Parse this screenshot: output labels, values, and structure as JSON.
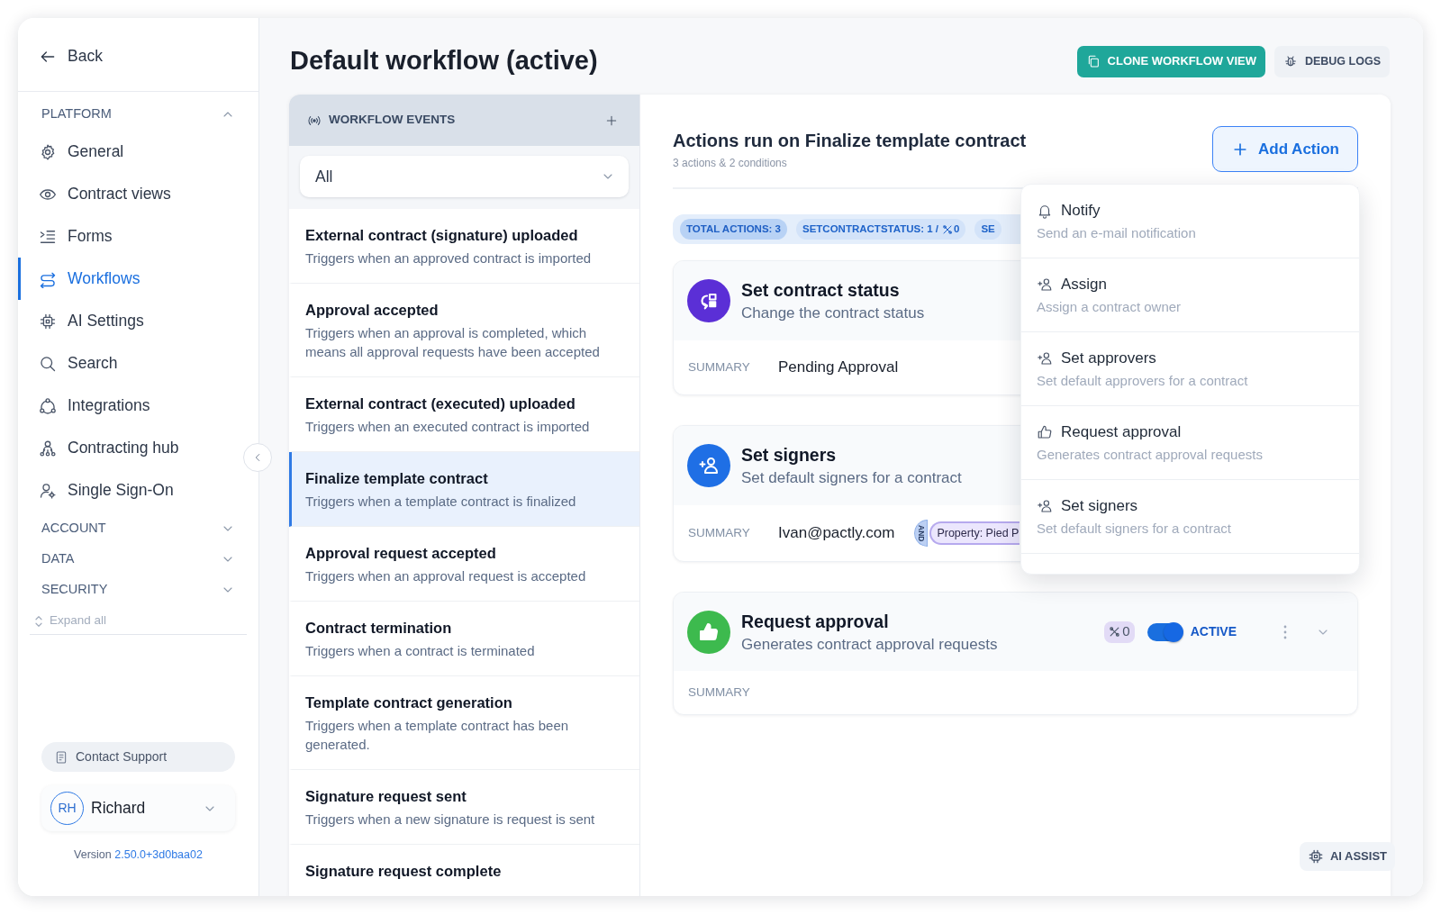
{
  "sidebar": {
    "back": "Back",
    "sections": [
      {
        "title": "PLATFORM",
        "expanded": true,
        "items": [
          {
            "label": "General",
            "selected": false
          },
          {
            "label": "Contract views",
            "selected": false
          },
          {
            "label": "Forms",
            "selected": false
          },
          {
            "label": "Workflows",
            "selected": true
          },
          {
            "label": "AI Settings",
            "selected": false
          },
          {
            "label": "Search",
            "selected": false
          },
          {
            "label": "Integrations",
            "selected": false
          },
          {
            "label": "Contracting hub",
            "selected": false
          },
          {
            "label": "Single Sign-On",
            "selected": false
          }
        ]
      },
      {
        "title": "ACCOUNT",
        "expanded": false
      },
      {
        "title": "DATA",
        "expanded": false
      },
      {
        "title": "SECURITY",
        "expanded": false
      }
    ],
    "expand_all": "Expand all",
    "contact_support": "Contact Support",
    "user": {
      "initials": "RH",
      "name": "Richard"
    },
    "version": {
      "label": "Version",
      "number": "2.50.0+3d0baa02"
    }
  },
  "header": {
    "title": "Default workflow (active)",
    "buttons": [
      {
        "label": "CLONE WORKFLOW VIEW",
        "kind": "primary"
      },
      {
        "label": "DEBUG LOGS",
        "kind": "secondary"
      }
    ]
  },
  "events": {
    "title": "WORKFLOW EVENTS",
    "filter": "All",
    "items": [
      {
        "title": "External contract (signature) uploaded",
        "description": "Triggers when an approved contract is imported",
        "selected": false
      },
      {
        "title": "Approval accepted",
        "description": "Triggers when an approval is completed, which means all approval requests have been accepted",
        "selected": false
      },
      {
        "title": "External contract (executed) uploaded",
        "description": "Triggers when an executed contract is imported",
        "selected": false
      },
      {
        "title": "Finalize template contract",
        "description": "Triggers when a template contract is finalized",
        "selected": true
      },
      {
        "title": "Approval request accepted",
        "description": "Triggers when an approval request is accepted",
        "selected": false
      },
      {
        "title": "Contract termination",
        "description": "Triggers when a contract is terminated",
        "selected": false
      },
      {
        "title": "Template contract generation",
        "description": "Triggers when a template contract has been generated.",
        "selected": false
      },
      {
        "title": "Signature request sent",
        "description": "Triggers when a new signature is request is sent",
        "selected": false
      },
      {
        "title": "Signature request complete",
        "selected": false
      }
    ]
  },
  "actions": {
    "title": "Actions run on Finalize template contract",
    "subtitle": "3 actions & 2 conditions",
    "add_button": "Add Action",
    "chips": [
      {
        "label": "TOTAL ACTIONS: 3",
        "selected": true
      },
      {
        "label": "SETCONTRACTSTATUS: 1 /",
        "count": "0",
        "selected": false
      },
      {
        "label": "SE",
        "selected": false
      }
    ],
    "cards": [
      {
        "kind": "status",
        "title": "Set contract status",
        "description": "Change the contract status",
        "summary_label": "SUMMARY",
        "summary": "Pending Approval"
      },
      {
        "kind": "signers",
        "title": "Set signers",
        "description": "Set default signers for a contract",
        "summary_label": "SUMMARY",
        "summary": "Ivan@pactly.com",
        "condition": {
          "operator": "AND",
          "label": "Property: Pied P"
        }
      },
      {
        "kind": "approval",
        "title": "Request approval",
        "description": "Generates contract approval requests",
        "summary_label": "SUMMARY",
        "condition_count": "0",
        "active": true,
        "status_label": "ACTIVE"
      }
    ]
  },
  "add_action_menu": {
    "items": [
      {
        "kind": "notify",
        "title": "Notify",
        "description": "Send an e-mail notification"
      },
      {
        "kind": "assign",
        "title": "Assign",
        "description": "Assign a contract owner"
      },
      {
        "kind": "assign",
        "title": "Set approvers",
        "description": "Set default approvers for a contract"
      },
      {
        "kind": "approval",
        "title": "Request approval",
        "description": "Generates contract approval requests"
      },
      {
        "kind": "assign",
        "title": "Set signers",
        "description": "Set default signers for a contract"
      }
    ]
  },
  "ai_assist": "AI ASSIST"
}
